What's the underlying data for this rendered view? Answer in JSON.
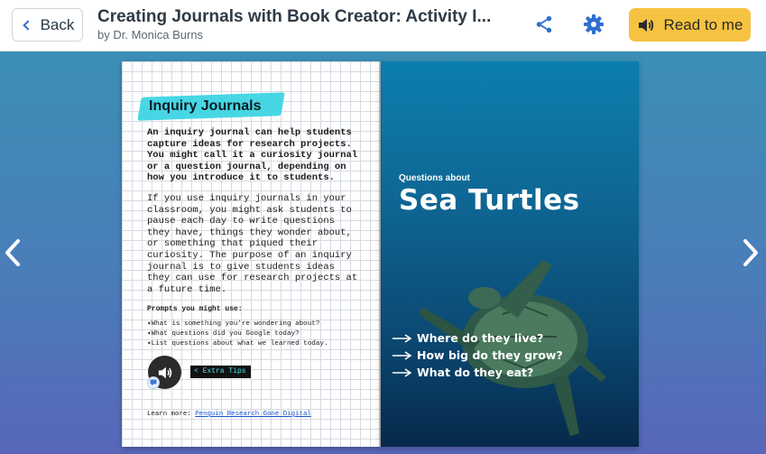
{
  "header": {
    "back_label": "Back",
    "title": "Creating Journals with Book Creator: Activity I...",
    "author": "by Dr. Monica Burns",
    "read_label": "Read to me"
  },
  "left_page": {
    "heading": "Inquiry Journals",
    "para1": "An inquiry journal can help students capture ideas for research projects. You might call it a curiosity journal or a question journal, depending on how you introduce it to students.",
    "para2": "If you use inquiry journals in your classroom, you might ask students to pause each day to write questions they have, things they wonder about, or something that piqued their curiosity. The purpose of an inquiry journal is to give students ideas they can use for research projects at a future time.",
    "prompts_title": "Prompts you might use:",
    "prompts": [
      "What is something you're wondering about?",
      "What questions did you Google today?",
      "List questions about what we learned today."
    ],
    "tips_label": "< Extra Tips",
    "learn_more_prefix": "Learn more: ",
    "learn_more_link": "Penguin Research Gone Digital"
  },
  "right_page": {
    "kicker": "Questions about",
    "title": "Sea Turtles",
    "questions": [
      "Where do they live?",
      "How big do they grow?",
      "What do they eat?"
    ]
  },
  "colors": {
    "accent": "#f5c341",
    "brand_blue": "#2f6fd0",
    "highlight": "#3dd5e3"
  },
  "icons": [
    "chevron-left-icon",
    "share-icon",
    "gear-icon",
    "speaker-icon",
    "chat-icon",
    "arrow-right-icon"
  ]
}
